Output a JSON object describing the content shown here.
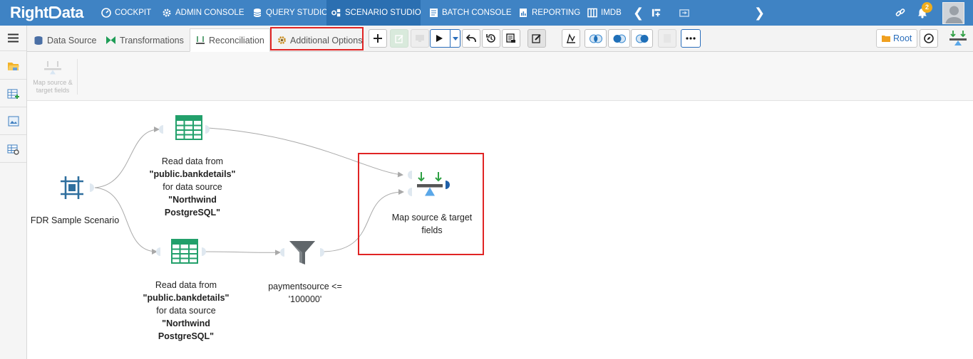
{
  "app": {
    "logo_text": "RightData"
  },
  "topnav": {
    "items": [
      {
        "label": "COCKPIT",
        "icon": "speedometer-icon"
      },
      {
        "label": "ADMIN CONSOLE",
        "icon": "gear-icon"
      },
      {
        "label": "QUERY STUDIO",
        "icon": "database-icon"
      },
      {
        "label": "SCENARIO STUDIO",
        "icon": "scenario-icon",
        "active": true
      },
      {
        "label": "BATCH CONSOLE",
        "icon": "batch-icon"
      },
      {
        "label": "REPORTING",
        "icon": "report-icon"
      },
      {
        "label": "IMDB",
        "icon": "columns-icon"
      }
    ],
    "notification_count": "2"
  },
  "tabs": [
    {
      "label": "Data Source",
      "icon": "datasource-icon"
    },
    {
      "label": "Transformations",
      "icon": "transform-icon"
    },
    {
      "label": "Reconciliation",
      "icon": "reconcile-icon",
      "active": true
    },
    {
      "label": "Additional Options",
      "icon": "gear-icon",
      "highlighted": true
    }
  ],
  "toolbar": {
    "root_label": "Root"
  },
  "ribbon": {
    "map_label": "Map source & target fields"
  },
  "canvas": {
    "scenario": {
      "label": "FDR Sample Scenario"
    },
    "source1": {
      "line1": "Read data from",
      "line2": "\"public.bankdetails\"",
      "line3": "for data source",
      "line4": "\"Northwind",
      "line5": "PostgreSQL\""
    },
    "source2": {
      "line1": "Read data from",
      "line2": "\"public.bankdetails\"",
      "line3": "for data source",
      "line4": "\"Northwind",
      "line5": "PostgreSQL\""
    },
    "filter": {
      "line1": "paymentsource <=",
      "line2": "'100000'"
    },
    "map": {
      "line1": "Map source & target",
      "line2": "fields"
    }
  },
  "colors": {
    "nav_blue": "#3f83c4",
    "highlight_red": "#e02424",
    "table_green": "#22a06b",
    "scenario_blue": "#2f6f9e"
  }
}
